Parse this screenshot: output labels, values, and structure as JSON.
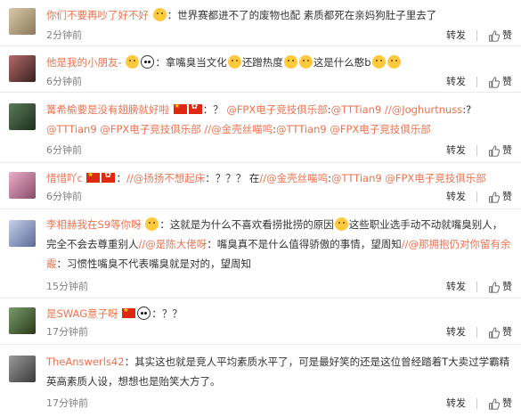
{
  "comments": [
    {
      "user": "你们不要再吵了好不好",
      "body": "：世界赛都进不了的废物也配 素质都死在亲妈狗肚子里去了",
      "time": "2分钟前"
    },
    {
      "user": "他是我的小朋友-",
      "body_1": "拿嘴臭当文化",
      "body_2": "还蹭热度",
      "body_3": "这是什么憨b",
      "time": "6分钟前"
    },
    {
      "user": "篝希榆要是没有翅膀就好啦",
      "body_1": "：？",
      "mentions": [
        "@FPX电子竞技俱乐部",
        "@TTTian9",
        "//@Joghurtnuss",
        "@TTTian9",
        "@FPX电子竞技俱乐部",
        "//@金壳丝喵呜",
        "@TTTian9",
        "@FPX电子竞技俱乐部"
      ],
      "time": "6分钟前"
    },
    {
      "user": "惜惜吖c",
      "body_1": "：",
      "mentions": [
        "//@扬扬不想起床",
        "//@金壳丝喵呜",
        "@TTTian9",
        "@FPX电子竞技俱乐部"
      ],
      "body_mid": "：？？？  在",
      "time": "6分钟前"
    },
    {
      "user": "李相赫我在S9等你呀",
      "body_1": "：这就是为什么不喜欢看捞批捞的原因",
      "body_2": "这些职业选手动不动就嘴臭别人，完全不会去尊重别人",
      "mention_1": "//@是陈大佬呀",
      "body_3": "：嘴臭真不是什么值得骄傲的事情，望周知",
      "mention_2": "//@那拥抱仍对你留有余霰",
      "body_4": "：习惯性嘴臭不代表嘴臭就是对的，望周知",
      "time": "15分钟前"
    },
    {
      "user": "是SWAG意子呀",
      "body": "：？？",
      "time": "17分钟前"
    },
    {
      "user": "TheAnswerls42",
      "body": "：其实这也就是竞人平均素质水平了，可是最好笑的还是这位曾经踏着T大卖过学霸精英高素质人设，想想也是贻笑大方了。",
      "time": "17分钟前"
    }
  ],
  "actions": {
    "repost_label": "转发",
    "like_label": "赞"
  },
  "colors": {
    "accent": "#eb7350",
    "meta": "#808080"
  }
}
